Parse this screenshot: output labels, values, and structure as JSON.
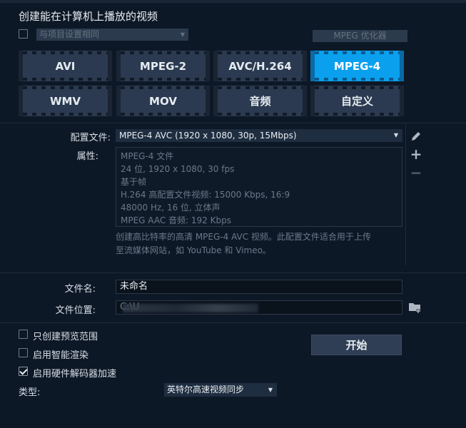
{
  "header": {
    "title": "创建能在计算机上播放的视频"
  },
  "same_as_project": {
    "label": "与项目设置相同",
    "checked": false
  },
  "mpeg_optimizer": {
    "label": "MPEG 优化器"
  },
  "formats": [
    {
      "label": "AVI"
    },
    {
      "label": "MPEG-2"
    },
    {
      "label": "AVC/H.264"
    },
    {
      "label": "MPEG-4",
      "active": true
    },
    {
      "label": "WMV"
    },
    {
      "label": "MOV"
    },
    {
      "label": "音频"
    },
    {
      "label": "自定义"
    }
  ],
  "profile": {
    "label": "配置文件:",
    "value": "MPEG-4 AVC (1920 x 1080, 30p, 15Mbps)"
  },
  "properties": {
    "label": "属性:",
    "lines": [
      "MPEG-4 文件",
      "24 位, 1920 x 1080, 30 fps",
      "基于帧",
      "H.264 高配置文件视频: 15000 Kbps, 16:9",
      "48000 Hz, 16 位, 立体声",
      "MPEG AAC 音频: 192 Kbps"
    ],
    "description_line1": "创建高比特率的高清 MPEG-4 AVC 视频。此配置文件适合用于上传",
    "description_line2": "至流媒体网站，如 YouTube 和 Vimeo。"
  },
  "side_icons": {
    "edit": "pencil-icon",
    "add": "+",
    "remove": "−"
  },
  "filename": {
    "label": "文件名:",
    "value": "未命名"
  },
  "filepath": {
    "label": "文件位置:",
    "value": "C:\\U"
  },
  "options": [
    {
      "label": "只创建预览范围",
      "checked": false
    },
    {
      "label": "启用智能渲染",
      "checked": false
    },
    {
      "label": "启用硬件解码器加速",
      "checked": true
    }
  ],
  "start_button": {
    "label": "开始"
  },
  "type_select": {
    "label": "类型:",
    "value": "英特尔高速视频同步"
  },
  "colors": {
    "accent": "#0aa0ee",
    "background": "#0d1826"
  }
}
